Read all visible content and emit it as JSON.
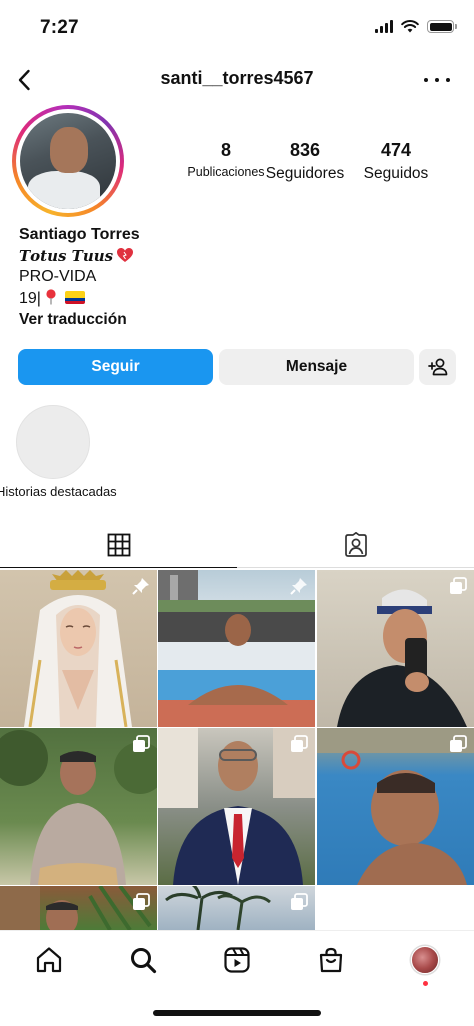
{
  "status_bar": {
    "time": "7:27"
  },
  "header": {
    "username": "santi__torres4567",
    "back_icon": "chevron-left-icon",
    "more_icon": "more-horizontal-icon"
  },
  "profile": {
    "stats": [
      {
        "number": "8",
        "label": "Publicaciones"
      },
      {
        "number": "836",
        "label": "Seguidores"
      },
      {
        "number": "474",
        "label": "Seguidos"
      }
    ],
    "name": "Santiago Torres",
    "bio_line1": "𝑻𝒐𝒕𝒖𝒔 𝑻𝒖𝒖𝒔",
    "bio_line1_emoji": "heart-icon",
    "bio_line2": "PRO-VIDA",
    "bio_line3": "19|",
    "bio_line3_emoji": [
      "pin-icon",
      "colombia-flag-icon"
    ],
    "translate_label": "Ver traducción"
  },
  "actions": {
    "follow_label": "Seguir",
    "message_label": "Mensaje",
    "add_user_icon": "add-user-icon"
  },
  "highlights": {
    "label": "Historias destacadas"
  },
  "tabs": [
    {
      "name": "grid",
      "icon": "grid-icon",
      "active": true
    },
    {
      "name": "tagged",
      "icon": "tagged-icon",
      "active": false
    }
  ],
  "posts": [
    {
      "subject": "virgin-statue",
      "badge": "pin-icon"
    },
    {
      "subject": "pool-edge",
      "badge": "pin-icon"
    },
    {
      "subject": "mirror-selfie",
      "badge": "carousel-icon"
    },
    {
      "subject": "park-portrait",
      "badge": "carousel-icon"
    },
    {
      "subject": "suit-portrait",
      "badge": "carousel-icon"
    },
    {
      "subject": "pool-profile",
      "badge": "carousel-icon"
    },
    {
      "subject": "garden-selfie",
      "badge": "carousel-icon"
    },
    {
      "subject": "palm-trees",
      "badge": "carousel-icon"
    }
  ],
  "bottom_nav": [
    "home-icon",
    "search-icon",
    "reels-icon",
    "shop-icon",
    "profile-avatar"
  ],
  "colors": {
    "accent": "#1a96f0",
    "secondary_button": "#efefef",
    "notification_dot": "#ff3040"
  }
}
